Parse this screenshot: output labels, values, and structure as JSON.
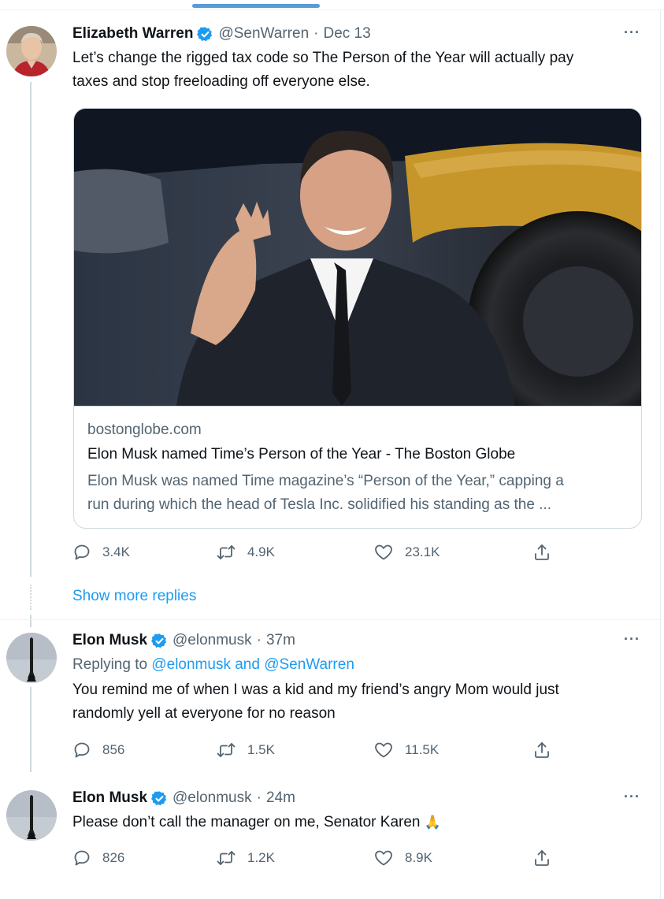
{
  "colors": {
    "link": "#1d9bf0",
    "muted": "#536471",
    "text": "#0f1419",
    "border": "#cfd9de",
    "verified": "#1d9bf0"
  },
  "tweets": [
    {
      "name": "Elizabeth Warren",
      "handle": "@SenWarren",
      "time_sep": "·",
      "time": "Dec 13",
      "more": "···",
      "lines": [
        "Let’s change the rigged tax code so The Person of the Year will actually pay",
        "taxes and stop freeloading off everyone else."
      ],
      "card": {
        "domain": "bostonglobe.com",
        "title": "Elon Musk named Time’s Person of the Year - The Boston Globe",
        "desc_lines": [
          "Elon Musk was named Time magazine’s “Person of the Year,” capping a",
          "run during which the head of Tesla Inc. solidified his standing as the ..."
        ]
      },
      "stats": {
        "replies": "3.4K",
        "retweets": "4.9K",
        "likes": "23.1K"
      }
    },
    {
      "name": "Elon Musk",
      "handle": "@elonmusk",
      "time_sep": "·",
      "time": "37m",
      "more": "···",
      "replying_prefix": "Replying to",
      "replying_to": "@elonmusk and @SenWarren",
      "lines": [
        "You remind me of when I was a kid and my friend’s angry Mom would just",
        "randomly yell at everyone for no reason"
      ],
      "stats": {
        "replies": "856",
        "retweets": "1.5K",
        "likes": "11.5K"
      }
    },
    {
      "name": "Elon Musk",
      "handle": "@elonmusk",
      "time_sep": "·",
      "time": "24m",
      "more": "···",
      "lines": [
        "Please don’t call the manager on me, Senator Karen"
      ],
      "emoji": "🙏",
      "stats": {
        "replies": "826",
        "retweets": "1.2K",
        "likes": "8.9K"
      }
    }
  ],
  "show_more_replies": "Show more replies",
  "icons": [
    "reply-icon",
    "retweet-icon",
    "like-icon",
    "share-icon",
    "verified-badge-icon",
    "more-icon"
  ]
}
